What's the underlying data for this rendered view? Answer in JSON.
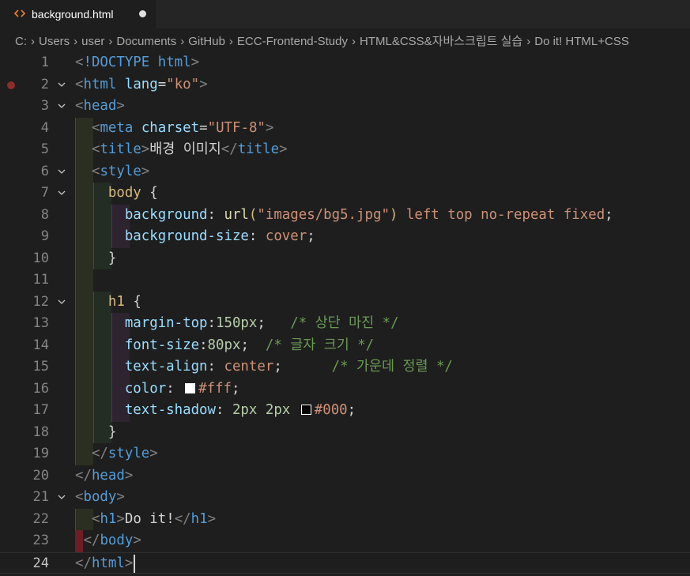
{
  "tab": {
    "filename": "background.html",
    "icon": "html-file-icon",
    "modified": true
  },
  "breadcrumb": [
    "C:",
    "Users",
    "user",
    "Documents",
    "GitHub",
    "ECC-Frontend-Study",
    "HTML&CSS&자바스크립트 실습",
    "Do it! HTML+CSS"
  ],
  "colors": {
    "swatch_white": "#ffffff",
    "swatch_black": "#000000"
  },
  "current_line": 24,
  "lines": [
    {
      "n": "1",
      "fold": false,
      "guides": [],
      "tokens": [
        [
          "punc",
          "<"
        ],
        [
          "tag",
          "!DOCTYPE"
        ],
        [
          "text",
          " "
        ],
        [
          "tag",
          "html"
        ],
        [
          "punc",
          ">"
        ]
      ]
    },
    {
      "n": "2",
      "fold": true,
      "breakpoint": true,
      "guides": [],
      "tokens": [
        [
          "punc",
          "<"
        ],
        [
          "tag",
          "html"
        ],
        [
          "text",
          " "
        ],
        [
          "attr",
          "lang"
        ],
        [
          "text",
          "="
        ],
        [
          "str",
          "\"ko\""
        ],
        [
          "punc",
          ">"
        ]
      ]
    },
    {
      "n": "3",
      "fold": true,
      "guides": [],
      "tokens": [
        [
          "punc",
          "<"
        ],
        [
          "tag",
          "head"
        ],
        [
          "punc",
          ">"
        ]
      ]
    },
    {
      "n": "4",
      "fold": false,
      "guides": [
        "g1"
      ],
      "tokens": [
        [
          "text",
          "  "
        ],
        [
          "punc",
          "<"
        ],
        [
          "tag",
          "meta"
        ],
        [
          "text",
          " "
        ],
        [
          "attr",
          "charset"
        ],
        [
          "text",
          "="
        ],
        [
          "str",
          "\"UTF-8\""
        ],
        [
          "punc",
          ">"
        ]
      ]
    },
    {
      "n": "5",
      "fold": false,
      "guides": [
        "g1"
      ],
      "tokens": [
        [
          "text",
          "  "
        ],
        [
          "punc",
          "<"
        ],
        [
          "tag",
          "title"
        ],
        [
          "punc",
          ">"
        ],
        [
          "text",
          "배경 이미지"
        ],
        [
          "punc",
          "</"
        ],
        [
          "tag",
          "title"
        ],
        [
          "punc",
          ">"
        ]
      ]
    },
    {
      "n": "6",
      "fold": true,
      "guides": [
        "g1"
      ],
      "tokens": [
        [
          "text",
          "  "
        ],
        [
          "punc",
          "<"
        ],
        [
          "tag",
          "style"
        ],
        [
          "punc",
          ">"
        ]
      ]
    },
    {
      "n": "7",
      "fold": true,
      "guides": [
        "g1",
        "g2"
      ],
      "tokens": [
        [
          "text",
          "    "
        ],
        [
          "sel",
          "body"
        ],
        [
          "text",
          " {"
        ]
      ]
    },
    {
      "n": "8",
      "fold": false,
      "guides": [
        "g1",
        "g2",
        "g3"
      ],
      "tokens": [
        [
          "text",
          "      "
        ],
        [
          "prop",
          "background"
        ],
        [
          "text",
          ": "
        ],
        [
          "fn",
          "url"
        ],
        [
          "sel",
          "("
        ],
        [
          "str",
          "\"images/bg5.jpg\""
        ],
        [
          "sel",
          ")"
        ],
        [
          "text",
          " "
        ],
        [
          "val",
          "left top no-repeat fixed"
        ],
        [
          "text",
          ";"
        ]
      ]
    },
    {
      "n": "9",
      "fold": false,
      "guides": [
        "g1",
        "g2",
        "g3"
      ],
      "tokens": [
        [
          "text",
          "      "
        ],
        [
          "prop",
          "background-size"
        ],
        [
          "text",
          ": "
        ],
        [
          "val",
          "cover"
        ],
        [
          "text",
          ";"
        ]
      ]
    },
    {
      "n": "10",
      "fold": false,
      "guides": [
        "g1",
        "g2"
      ],
      "tokens": [
        [
          "text",
          "    "
        ],
        [
          "text",
          "}"
        ]
      ]
    },
    {
      "n": "11",
      "fold": false,
      "guides": [
        "g1"
      ],
      "tokens": []
    },
    {
      "n": "12",
      "fold": true,
      "guides": [
        "g1",
        "g2"
      ],
      "tokens": [
        [
          "text",
          "    "
        ],
        [
          "sel",
          "h1"
        ],
        [
          "text",
          " {"
        ]
      ]
    },
    {
      "n": "13",
      "fold": false,
      "guides": [
        "g1",
        "g2",
        "g3"
      ],
      "tokens": [
        [
          "text",
          "      "
        ],
        [
          "prop",
          "margin-top"
        ],
        [
          "text",
          ":"
        ],
        [
          "num",
          "150px"
        ],
        [
          "text",
          ";   "
        ],
        [
          "com",
          "/* 상단 마진 */"
        ]
      ]
    },
    {
      "n": "14",
      "fold": false,
      "guides": [
        "g1",
        "g2",
        "g3"
      ],
      "tokens": [
        [
          "text",
          "      "
        ],
        [
          "prop",
          "font-size"
        ],
        [
          "text",
          ":"
        ],
        [
          "num",
          "80px"
        ],
        [
          "text",
          ";  "
        ],
        [
          "com",
          "/* 글자 크기 */"
        ]
      ]
    },
    {
      "n": "15",
      "fold": false,
      "guides": [
        "g1",
        "g2",
        "g3"
      ],
      "tokens": [
        [
          "text",
          "      "
        ],
        [
          "prop",
          "text-align"
        ],
        [
          "text",
          ": "
        ],
        [
          "val",
          "center"
        ],
        [
          "text",
          ";      "
        ],
        [
          "com",
          "/* 가운데 정렬 */"
        ]
      ]
    },
    {
      "n": "16",
      "fold": false,
      "guides": [
        "g1",
        "g2",
        "g3"
      ],
      "tokens": [
        [
          "text",
          "      "
        ],
        [
          "prop",
          "color"
        ],
        [
          "text",
          ": "
        ],
        [
          "swatch",
          "#ffffff"
        ],
        [
          "val",
          "#fff"
        ],
        [
          "text",
          ";"
        ]
      ]
    },
    {
      "n": "17",
      "fold": false,
      "guides": [
        "g1",
        "g2",
        "g3"
      ],
      "tokens": [
        [
          "text",
          "      "
        ],
        [
          "prop",
          "text-shadow"
        ],
        [
          "text",
          ": "
        ],
        [
          "num",
          "2px"
        ],
        [
          "text",
          " "
        ],
        [
          "num",
          "2px"
        ],
        [
          "text",
          " "
        ],
        [
          "swatch",
          "#000000"
        ],
        [
          "val",
          "#000"
        ],
        [
          "text",
          ";"
        ]
      ]
    },
    {
      "n": "18",
      "fold": false,
      "guides": [
        "g1",
        "g2"
      ],
      "tokens": [
        [
          "text",
          "    "
        ],
        [
          "text",
          "}"
        ]
      ]
    },
    {
      "n": "19",
      "fold": false,
      "guides": [
        "g1"
      ],
      "tokens": [
        [
          "text",
          "  "
        ],
        [
          "punc",
          "</"
        ],
        [
          "tag",
          "style"
        ],
        [
          "punc",
          ">"
        ]
      ]
    },
    {
      "n": "20",
      "fold": false,
      "guides": [],
      "tokens": [
        [
          "punc",
          "</"
        ],
        [
          "tag",
          "head"
        ],
        [
          "punc",
          ">"
        ]
      ]
    },
    {
      "n": "21",
      "fold": true,
      "guides": [],
      "tokens": [
        [
          "punc",
          "<"
        ],
        [
          "tag",
          "body"
        ],
        [
          "punc",
          ">"
        ]
      ]
    },
    {
      "n": "22",
      "fold": false,
      "guides": [
        "g1"
      ],
      "tokens": [
        [
          "text",
          "  "
        ],
        [
          "punc",
          "<"
        ],
        [
          "tag",
          "h1"
        ],
        [
          "punc",
          ">"
        ],
        [
          "text",
          "Do it!"
        ],
        [
          "punc",
          "</"
        ],
        [
          "tag",
          "h1"
        ],
        [
          "punc",
          ">"
        ]
      ]
    },
    {
      "n": "23",
      "fold": false,
      "guides": [
        "gerr"
      ],
      "tokens": [
        [
          "text",
          " "
        ],
        [
          "punc",
          "</"
        ],
        [
          "tag",
          "body"
        ],
        [
          "punc",
          ">"
        ]
      ]
    },
    {
      "n": "24",
      "fold": false,
      "guides": [],
      "tokens": [
        [
          "punc",
          "</"
        ],
        [
          "tag",
          "html"
        ],
        [
          "punc",
          ">"
        ]
      ]
    }
  ]
}
